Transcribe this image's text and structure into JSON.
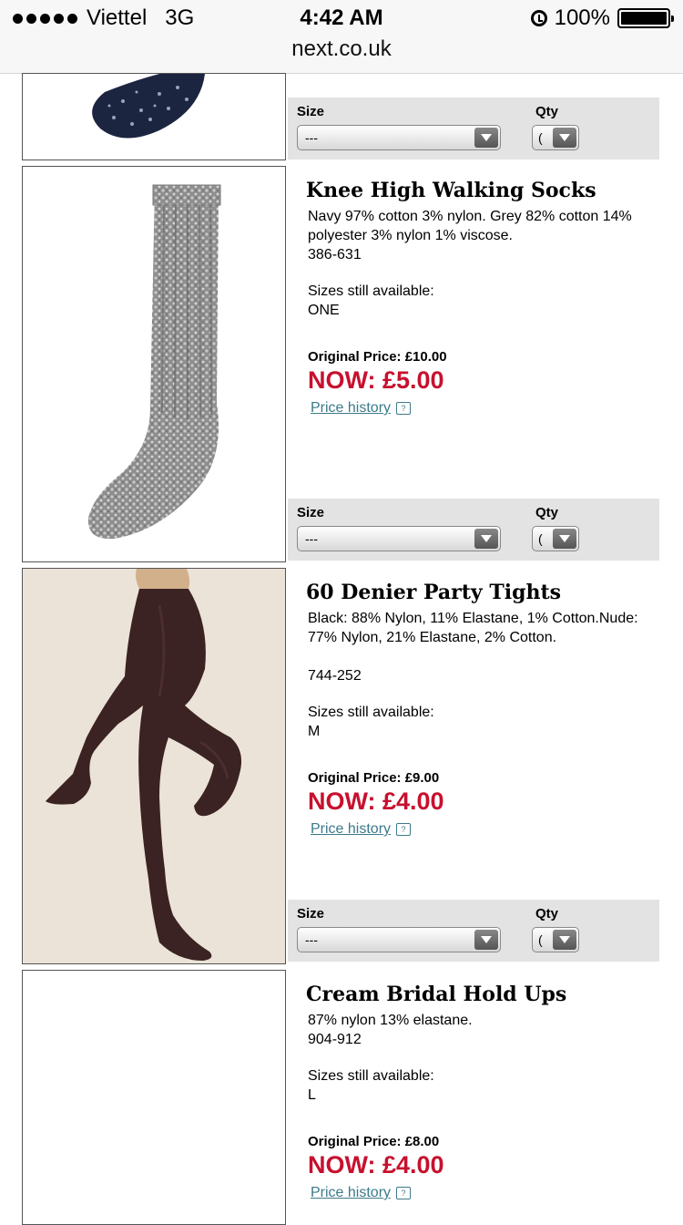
{
  "status_bar": {
    "carrier": "Viettel",
    "network": "3G",
    "time": "4:42 AM",
    "battery": "100%"
  },
  "url_bar": {
    "domain": "next.co.uk"
  },
  "form_labels": {
    "size": "Size",
    "qty": "Qty"
  },
  "products": [
    {
      "size_value": "---",
      "qty_value": "("
    },
    {
      "title": "Knee High Walking Socks",
      "description": "Navy 97% cotton 3% nylon. Grey 82% cotton 14% polyester 3% nylon 1% viscose.",
      "code": "386-631",
      "sizes_label": "Sizes still available:",
      "sizes": "ONE",
      "original_price": "Original Price: £10.00",
      "now_price": "NOW: £5.00",
      "history_label": "Price history",
      "size_value": "---",
      "qty_value": "("
    },
    {
      "title": "60 Denier Party Tights",
      "description": "Black: 88% Nylon, 11% Elastane, 1% Cotton.Nude: 77% Nylon, 21% Elastane, 2% Cotton.",
      "code": "744-252",
      "sizes_label": "Sizes still available:",
      "sizes": "M",
      "original_price": "Original Price: £9.00",
      "now_price": "NOW: £4.00",
      "history_label": "Price history",
      "size_value": "---",
      "qty_value": "("
    },
    {
      "title": "Cream Bridal Hold Ups",
      "description": "87% nylon 13% elastane.",
      "code": "904-912",
      "sizes_label": "Sizes still available:",
      "sizes": "L",
      "original_price": "Original Price: £8.00",
      "now_price": "NOW: £4.00",
      "history_label": "Price history"
    }
  ]
}
